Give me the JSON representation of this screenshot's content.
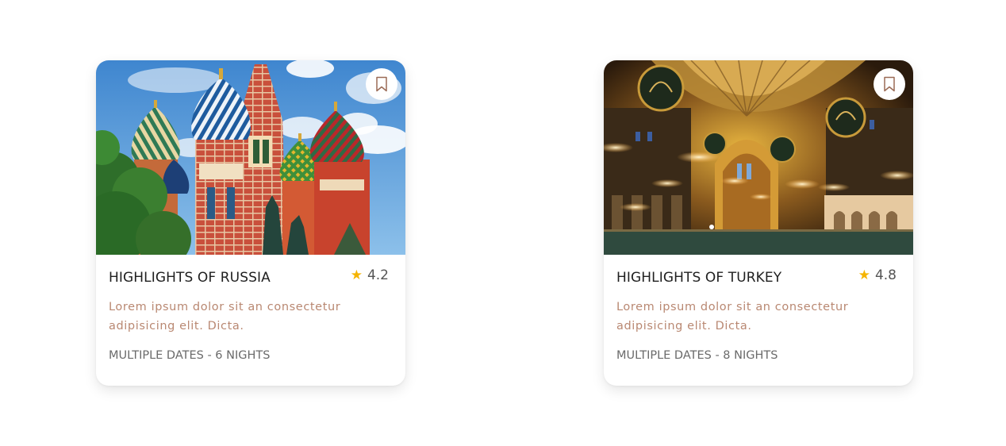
{
  "colors": {
    "star": "#f5b400",
    "description": "#b98872",
    "bookmark_stroke": "#9a6a55"
  },
  "cards": [
    {
      "image_subject": "Saint Basil's Cathedral domes against blue sky",
      "title": "HIGHLIGHTS OF RUSSIA",
      "rating": "4.2",
      "description": "Lorem ipsum dolor sit an consectetur adipisicing elit. Dicta.",
      "dates": "MULTIPLE DATES - 6 NIGHTS",
      "bookmark_icon": "bookmark-icon",
      "star_icon": "star-icon"
    },
    {
      "image_subject": "Hagia Sophia interior with domes and hanging lamps",
      "title": "HIGHLIGHTS OF TURKEY",
      "rating": "4.8",
      "description": "Lorem ipsum dolor sit an consectetur adipisicing elit. Dicta.",
      "dates": "MULTIPLE DATES - 8 NIGHTS",
      "bookmark_icon": "bookmark-icon",
      "star_icon": "star-icon"
    }
  ]
}
